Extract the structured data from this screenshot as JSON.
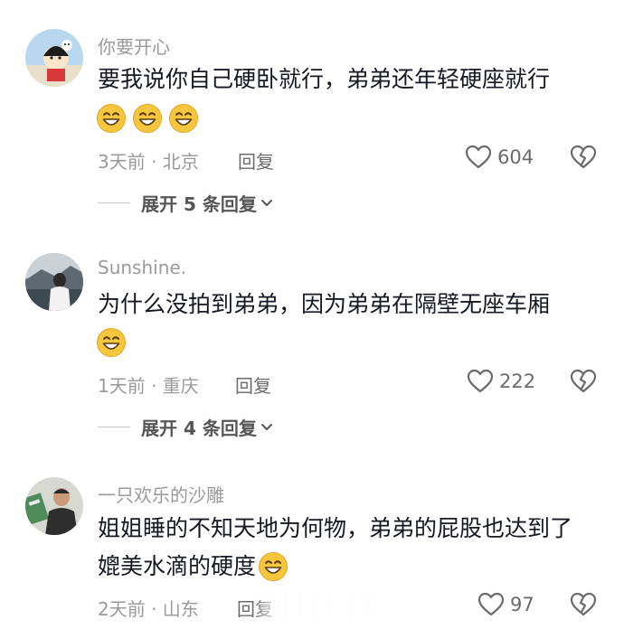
{
  "comments": [
    {
      "username": "你要开心",
      "text": "要我说你自己硬卧就行，弟弟还年轻硬座就行",
      "emoji_count": 3,
      "time_location": "3天前 · 北京",
      "reply_label": "回复",
      "likes": "604",
      "expand_label": "展开 5 条回复"
    },
    {
      "username": "Sunshine.",
      "text": "为什么没拍到弟弟，因为弟弟在隔壁无座车厢",
      "emoji_count": 1,
      "time_location": "1天前 · 重庆",
      "reply_label": "回复",
      "likes": "222",
      "expand_label": "展开 4 条回复"
    },
    {
      "username": "一只欢乐的沙雕",
      "text_line1": "姐姐睡的不知天地为何物，弟弟的屁股也达到了",
      "text_line2": "媲美水滴的硬度",
      "emoji_count": 1,
      "time_location": "2天前 · 山东",
      "reply_label": "回复",
      "likes": "97"
    }
  ],
  "icons": {
    "like": "heart-outline-icon",
    "dislike": "broken-heart-icon",
    "emoji": "grinning-emoji-icon",
    "expand": "chevron-down-icon"
  },
  "colors": {
    "secondary_text": "#9a9a9a",
    "body_text": "#161823",
    "emoji_face": "#f6c63c"
  }
}
